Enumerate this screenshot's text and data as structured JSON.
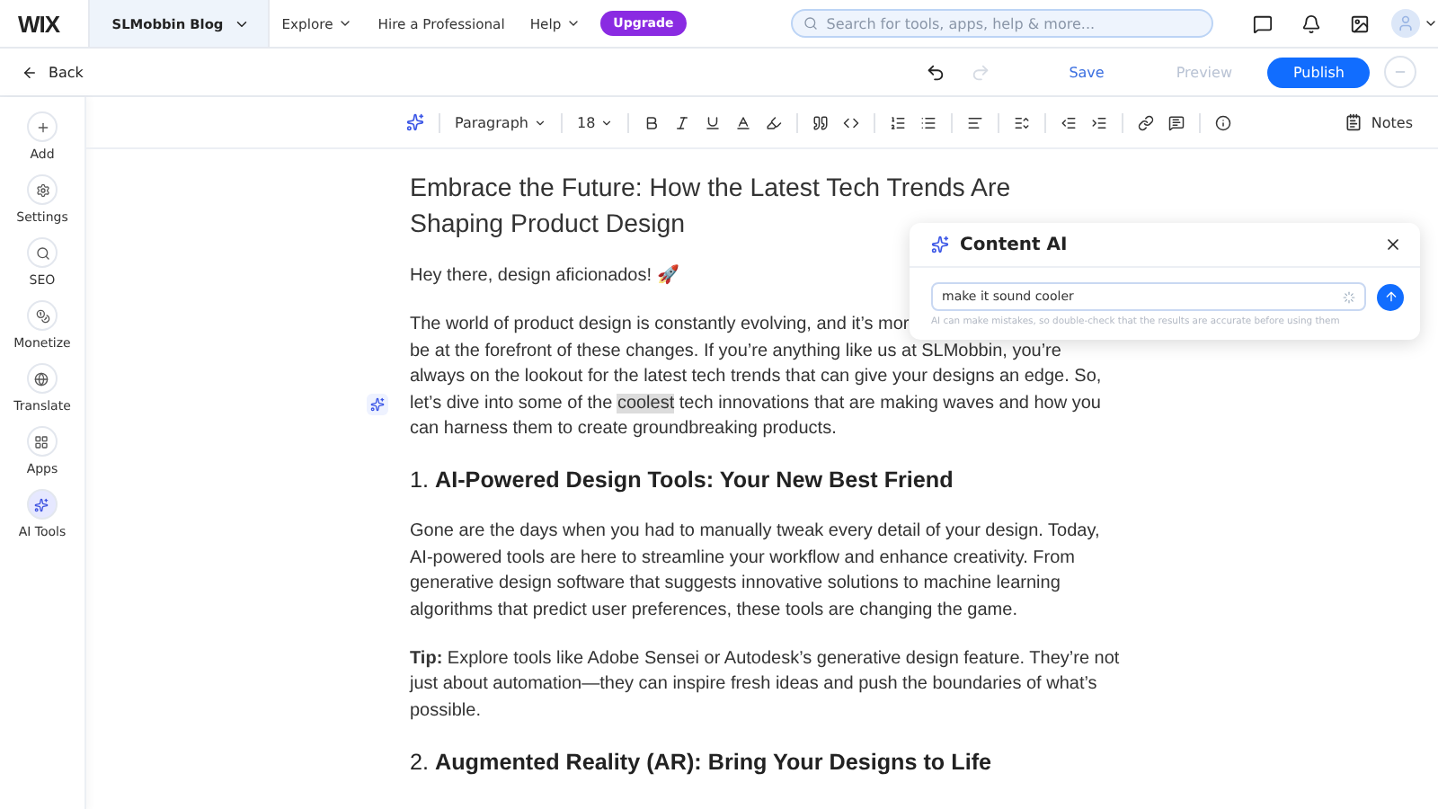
{
  "top_bar": {
    "logo": "WIX",
    "site": "SLMobbin Blog",
    "nav": [
      {
        "label": "Explore",
        "dropdown": true
      },
      {
        "label": "Hire a Professional",
        "dropdown": false
      },
      {
        "label": "Help",
        "dropdown": true
      }
    ],
    "upgrade": "Upgrade",
    "search": {
      "placeholder": "Search for tools, apps, help & more..."
    }
  },
  "action_bar": {
    "back": "Back",
    "redo_disabled": true,
    "save": "Save",
    "preview": {
      "label": "Preview",
      "disabled": true
    },
    "publish": "Publish"
  },
  "toolbar": {
    "style": "Paragraph",
    "size": "18",
    "notes": "Notes"
  },
  "sidebar": {
    "items": [
      {
        "kind": "add",
        "label": "Add",
        "selected": false
      },
      {
        "kind": "settings",
        "label": "Settings",
        "selected": false
      },
      {
        "kind": "seo",
        "label": "SEO",
        "selected": false
      },
      {
        "kind": "monetize",
        "label": "Monetize",
        "selected": false
      },
      {
        "kind": "translate",
        "label": "Translate",
        "selected": false
      },
      {
        "kind": "apps",
        "label": "Apps",
        "selected": false
      },
      {
        "kind": "ai",
        "label": "AI Tools",
        "selected": true
      }
    ]
  },
  "article": {
    "title": "Embrace the Future: How the Latest Tech Trends Are Shaping Product Design",
    "blocks": [
      {
        "kind": "para",
        "lines": [
          [
            {
              "text": "Hey there, design aficionados! 🚀",
              "selected": false
            }
          ]
        ]
      },
      {
        "kind": "para",
        "lines": [
          [
            {
              "text": "The world of product design is constantly evolving, and it’s mor",
              "selected": false
            }
          ],
          [
            {
              "text": "be at the forefront of these changes. If you’re anything like us at SLMobbin, you’re",
              "selected": false
            }
          ],
          [
            {
              "text": "always on the lookout for the latest tech trends that can give your designs an edge. So,",
              "selected": false
            }
          ],
          [
            {
              "text": "let’s dive into some of the ",
              "selected": false
            },
            {
              "text": "coolest",
              "selected": true
            },
            {
              "text": " tech innovations that are making waves and how you",
              "selected": false
            }
          ],
          [
            {
              "text": "can harness them to create groundbreaking products.",
              "selected": false
            }
          ]
        ]
      },
      {
        "kind": "heading",
        "number": "1.",
        "text": "AI-Powered Design Tools: Your New Best Friend"
      },
      {
        "kind": "para",
        "lines": [
          [
            {
              "text": "Gone are the days when you had to manually tweak every detail of your design. Today,",
              "selected": false
            }
          ],
          [
            {
              "text": "AI-powered tools are here to streamline your workflow and enhance creativity. From",
              "selected": false
            }
          ],
          [
            {
              "text": "generative design software that suggests innovative solutions to machine learning",
              "selected": false
            }
          ],
          [
            {
              "text": "algorithms that predict user preferences, these tools are changing the game.",
              "selected": false
            }
          ]
        ]
      },
      {
        "kind": "para",
        "lines": [
          [
            {
              "text": "**Tip:** Explore tools like Adobe Sensei or Autodesk’s generative design feature. They’re not",
              "selected": false
            }
          ],
          [
            {
              "text": "just about automation—they can inspire fresh ideas and push the boundaries of what’s",
              "selected": false
            }
          ],
          [
            {
              "text": "possible.",
              "selected": false
            }
          ]
        ]
      },
      {
        "kind": "heading",
        "number": "2.",
        "text": "Augmented Reality (AR): Bring Your Designs to Life"
      }
    ]
  },
  "content_ai": {
    "title": "Content AI",
    "prompt": "make it sound cooler",
    "disclaimer": "AI can make mistakes, so double-check that the results are accurate before using them"
  }
}
